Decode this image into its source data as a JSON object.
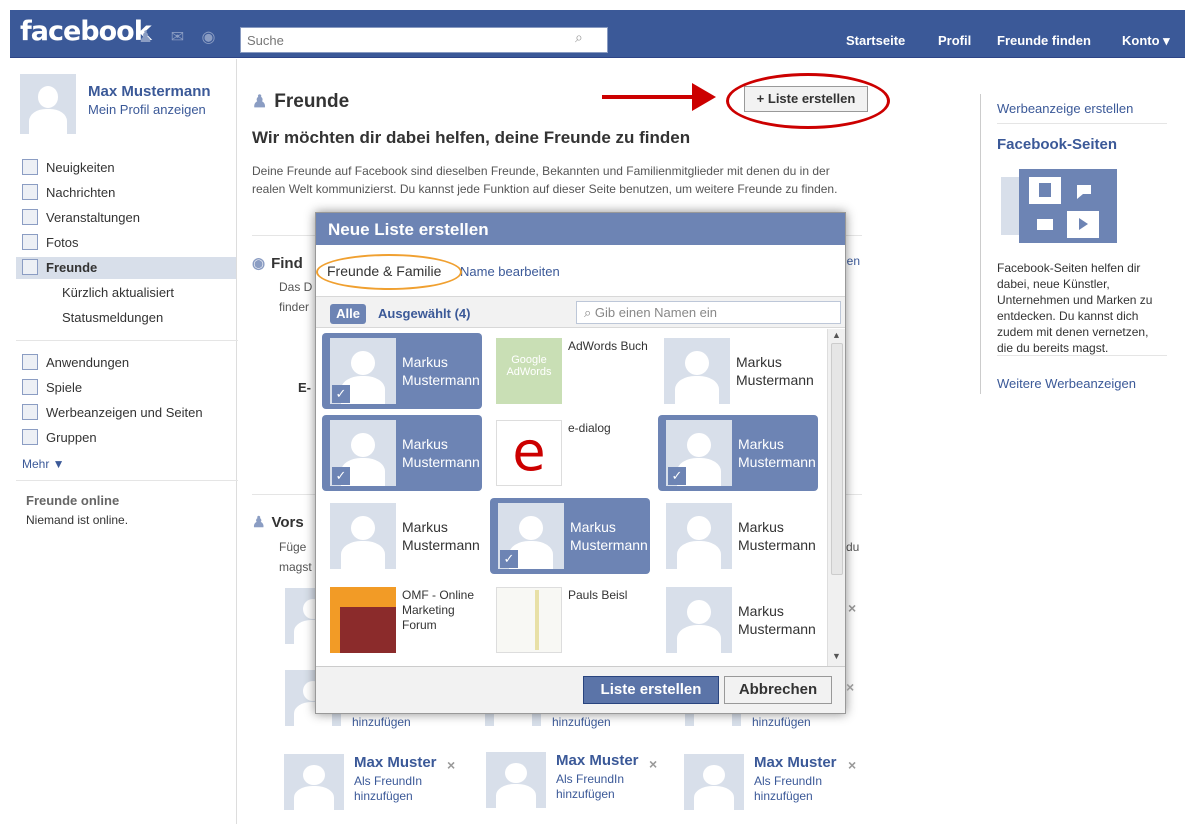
{
  "topbar": {
    "logo": "facebook",
    "search_placeholder": "Suche",
    "nav": [
      "Startseite",
      "Profil",
      "Freunde finden",
      "Konto ▾"
    ]
  },
  "left": {
    "user_name": "Max Mustermann",
    "profile_link": "Mein Profil anzeigen",
    "items": [
      {
        "label": "Neuigkeiten"
      },
      {
        "label": "Nachrichten"
      },
      {
        "label": "Veranstaltungen"
      },
      {
        "label": "Fotos"
      },
      {
        "label": "Freunde"
      },
      {
        "label": "Kürzlich aktualisiert"
      },
      {
        "label": "Statusmeldungen"
      },
      {
        "label": "Anwendungen"
      },
      {
        "label": "Spiele"
      },
      {
        "label": "Werbeanzeigen und Seiten"
      },
      {
        "label": "Gruppen"
      }
    ],
    "more": "Mehr ▼",
    "online_title": "Freunde online",
    "online_text": "Niemand ist online."
  },
  "main": {
    "title": "Freunde",
    "create_button": "+ Liste erstellen",
    "heading": "Wir möchten dir dabei helfen, deine Freunde zu finden",
    "description": "Deine Freunde auf Facebook sind dieselben Freunde, Bekannten und Familienmitglieder mit denen du in der realen Welt kommunizierst. Du kannst jede Funktion auf dieser Seite benutzen, um weitere Freunde zu finden.",
    "find_title": "Find",
    "find_text_1": "Das D",
    "find_text_2": "finder",
    "find_email": "E-",
    "find_link": "len",
    "suggest_title": "Vors",
    "suggest_text_1": "Füge",
    "suggest_text_2": "magst",
    "suggest_tail": "du",
    "add_text": "hinzufügen",
    "suggestions": [
      {
        "name": "Max Muster",
        "sub": "Als FreundIn hinzufügen"
      },
      {
        "name": "Max Muster",
        "sub": "Als FreundIn hinzufügen"
      },
      {
        "name": "Max Muster",
        "sub": "Als FreundIn hinzufügen"
      }
    ]
  },
  "right": {
    "ad_link": "Werbeanzeige erstellen",
    "pages_title": "Facebook-Seiten",
    "pages_text": "Facebook-Seiten helfen dir dabei, neue Künstler, Unternehmen und Marken zu entdecken. Du kannst dich zudem mit denen vernetzen, die du bereits magst.",
    "more_ads": "Weitere Werbeanzeigen"
  },
  "modal": {
    "title": "Neue Liste erstellen",
    "list_name": "Freunde & Familie",
    "edit_link": "Name bearbeiten",
    "tab_all": "Alle",
    "tab_selected": "Ausgewählt (4)",
    "search_placeholder": "Gib einen Namen ein",
    "tiles": [
      {
        "label": "Markus Mustermann",
        "selected": true
      },
      {
        "label": "AdWords Buch",
        "selected": false
      },
      {
        "label": "Markus Mustermann",
        "selected": false
      },
      {
        "label": "Markus Mustermann",
        "selected": true
      },
      {
        "label": "e-dialog",
        "selected": false
      },
      {
        "label": "Markus Mustermann",
        "selected": true
      },
      {
        "label": "Markus Mustermann",
        "selected": false
      },
      {
        "label": "Markus Mustermann",
        "selected": true
      },
      {
        "label": "Markus Mustermann",
        "selected": false
      },
      {
        "label": "OMF - Online Marketing Forum",
        "selected": false
      },
      {
        "label": "Pauls Beisl",
        "selected": false
      },
      {
        "label": "Markus Mustermann",
        "selected": false
      }
    ],
    "google_text": "Google AdWords",
    "create_button": "Liste erstellen",
    "cancel_button": "Abbrechen"
  },
  "colors": {
    "facebook_blue": "#3b5998",
    "selected_tile": "#6d84b4",
    "red_annotation": "#cc0000",
    "orange_annotation": "#f0a030"
  },
  "icons": [
    "friends-icon",
    "messages-icon",
    "notifications-icon",
    "search-icon",
    "news-icon",
    "events-icon",
    "photos-icon",
    "apps-icon",
    "games-icon",
    "ads-icon",
    "groups-icon",
    "close-icon",
    "check-icon"
  ]
}
